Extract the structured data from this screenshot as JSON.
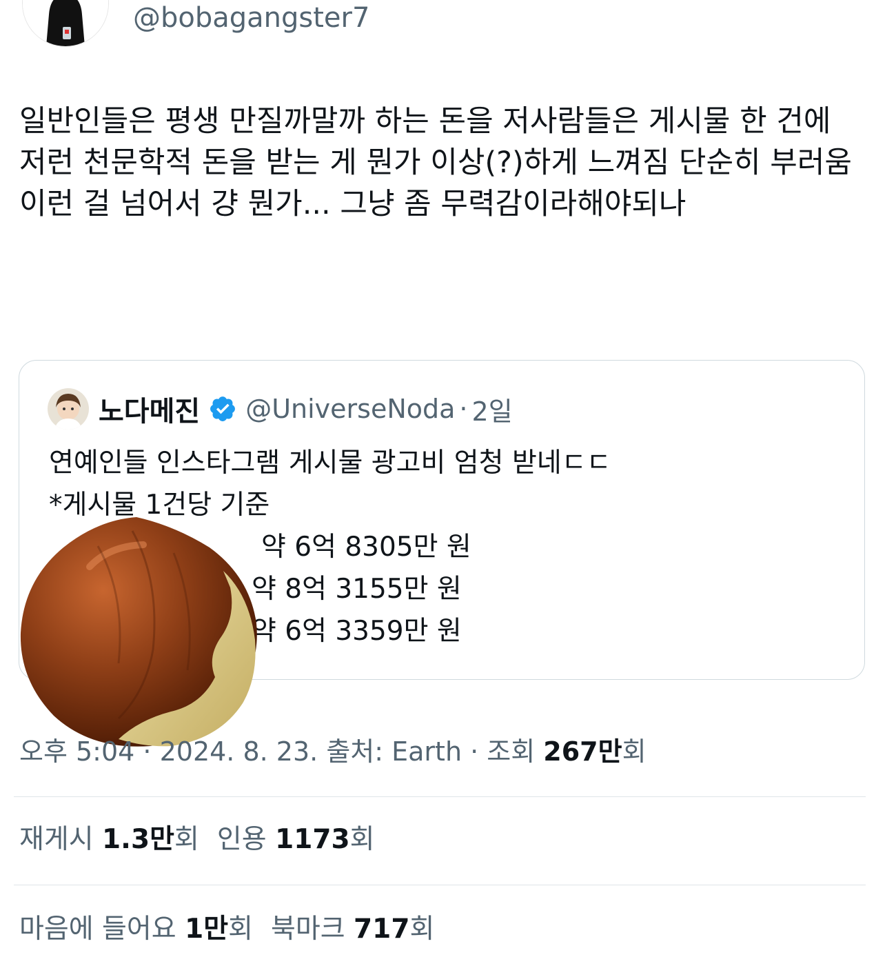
{
  "author": {
    "handle": "@bobagangster7"
  },
  "tweet": {
    "text": "일반인들은 평생 만질까말까 하는 돈을 저사람들은 게시물 한 건에 저런 천문학적 돈을 받는 게 뭔가 이상(?)하게 느껴짐 단순히 부러움 이런 걸 넘어서 걍 뭔가... 그냥 좀 무력감이라해야되나"
  },
  "quote": {
    "name": "노다메진",
    "handle": "@UniverseNoda",
    "separator": "·",
    "time": "2일",
    "lines": [
      "연예인들 인스타그램 게시물 광고비 엄청 받네ㄷㄷ",
      "*게시물 1건당 기준",
      "약 6억 8305만 원",
      "약 8억 3155만 원",
      "약 6억 3359만 원"
    ]
  },
  "meta": {
    "time": "오후 5:04",
    "sep1": " · ",
    "date": "2024. 8. 23.",
    "source_label": " 출처: ",
    "source": "Earth",
    "sep2": " · ",
    "views_label": "조회 ",
    "views_value": "267만",
    "views_unit": "회"
  },
  "stats_row1": {
    "reposts_label": "재게시 ",
    "reposts_value": "1.3만",
    "reposts_unit": "회",
    "quotes_label": "인용 ",
    "quotes_value": "1173",
    "quotes_unit": "회"
  },
  "stats_row2": {
    "likes_label": "마음에 들어요 ",
    "likes_value": "1만",
    "likes_unit": "회",
    "bookmarks_label": "북마크 ",
    "bookmarks_value": "717",
    "bookmarks_unit": "회"
  },
  "colors": {
    "text": "#0f1419",
    "secondary": "#536471",
    "verified": "#1d9bf0",
    "border": "#cfd9de"
  },
  "icons": {
    "verified": "verified-badge-icon",
    "overlay": "chestnut-icon"
  }
}
